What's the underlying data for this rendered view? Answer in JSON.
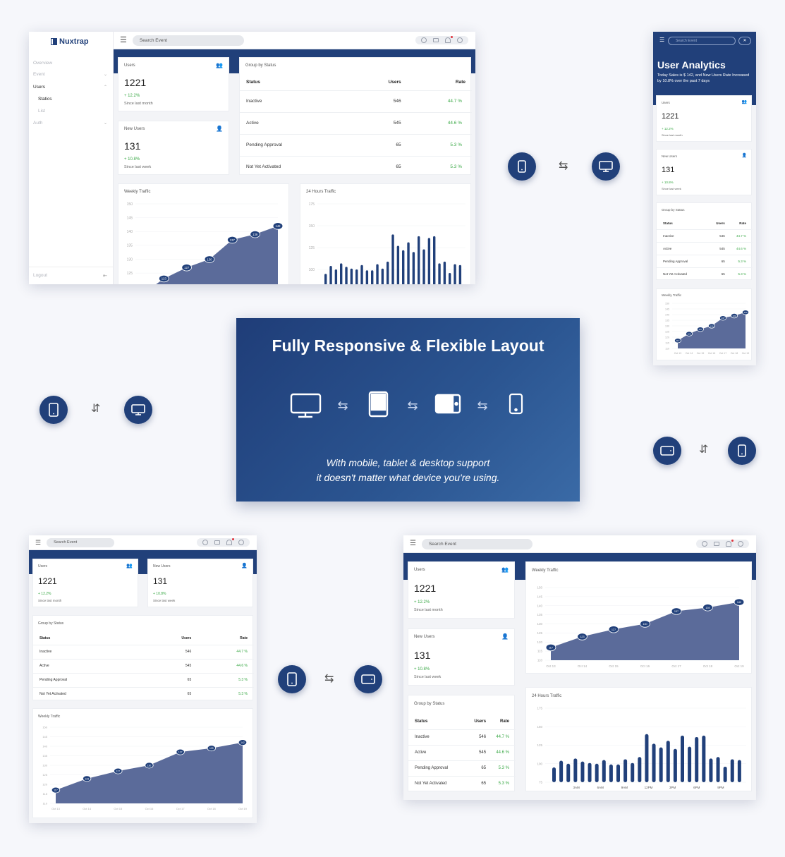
{
  "brand": {
    "name": "Nuxtrap"
  },
  "sidebar": {
    "items": [
      {
        "label": "Overview",
        "chevron": ""
      },
      {
        "label": "Event",
        "chevron": "⌄"
      },
      {
        "label": "Users",
        "chevron": "⌃"
      },
      {
        "label": "Statics",
        "chevron": ""
      },
      {
        "label": "List",
        "chevron": ""
      },
      {
        "label": "Auth",
        "chevron": "⌄"
      }
    ],
    "logout": "Logout"
  },
  "search": {
    "placeholder": "Search Event"
  },
  "icons": {
    "menu": "menu-icon",
    "refresh": "refresh-icon",
    "mail": "mail-icon",
    "bell": "bell-icon",
    "clock": "clock-icon",
    "users": "users-icon",
    "user_check": "user-check-icon"
  },
  "stats": {
    "users": {
      "title": "Users",
      "value": "1221",
      "delta": "+ 12.2%",
      "since": "Since last month"
    },
    "new_users": {
      "title": "New Users",
      "value": "131",
      "delta": "+ 10.8%",
      "since": "Since last week"
    }
  },
  "group_by_status": {
    "title": "Group by Status",
    "headers": [
      "Status",
      "Users",
      "Rate"
    ],
    "rows": [
      {
        "status": "Inactive",
        "users": "546",
        "rate": "44.7 %"
      },
      {
        "status": "Active",
        "users": "545",
        "rate": "44.6 %"
      },
      {
        "status": "Pending Approval",
        "users": "65",
        "rate": "5.3 %"
      },
      {
        "status": "Not Yet Activated",
        "users": "65",
        "rate": "5.3 %"
      }
    ]
  },
  "user_analytics": {
    "title": "User Analytics",
    "subtitle": "Today Sales is $ 142, and New Users Rate Increased by 10.8% over the past 7 days"
  },
  "hero": {
    "title": "Fully Responsive & Flexible Layout",
    "subtitle_line1": "With mobile, tablet & desktop support",
    "subtitle_line2": "it doesn't matter what device you're using."
  },
  "colors": {
    "primary": "#21407a",
    "area": "#5b6b9a",
    "positive": "#39a845"
  },
  "chart_data": [
    {
      "type": "area",
      "title": "Weekly Traffic",
      "categories": [
        "Oct 13",
        "Oct 14",
        "Oct 15",
        "Oct 16",
        "Oct 17",
        "Oct 18",
        "Oct 19"
      ],
      "values": [
        117,
        123,
        127,
        130,
        137,
        139,
        142
      ],
      "ylim": [
        110,
        150
      ],
      "yticks": [
        "150",
        "145",
        "140",
        "135",
        "130",
        "125",
        "120",
        "115",
        "110"
      ]
    },
    {
      "type": "bar",
      "title": "24 Hours Traffic",
      "categories": [
        "3AM",
        "6AM",
        "9AM",
        "12PM",
        "3PM",
        "6PM",
        "9PM"
      ],
      "values": [
        95,
        104,
        100,
        107,
        103,
        101,
        100,
        105,
        99,
        99,
        106,
        101,
        109,
        140,
        127,
        122,
        131,
        120,
        138,
        123,
        136,
        138,
        107,
        109,
        96,
        106,
        105
      ],
      "ylim": [
        75,
        175
      ],
      "yticks": [
        "175",
        "150",
        "125",
        "100",
        "75"
      ]
    }
  ]
}
